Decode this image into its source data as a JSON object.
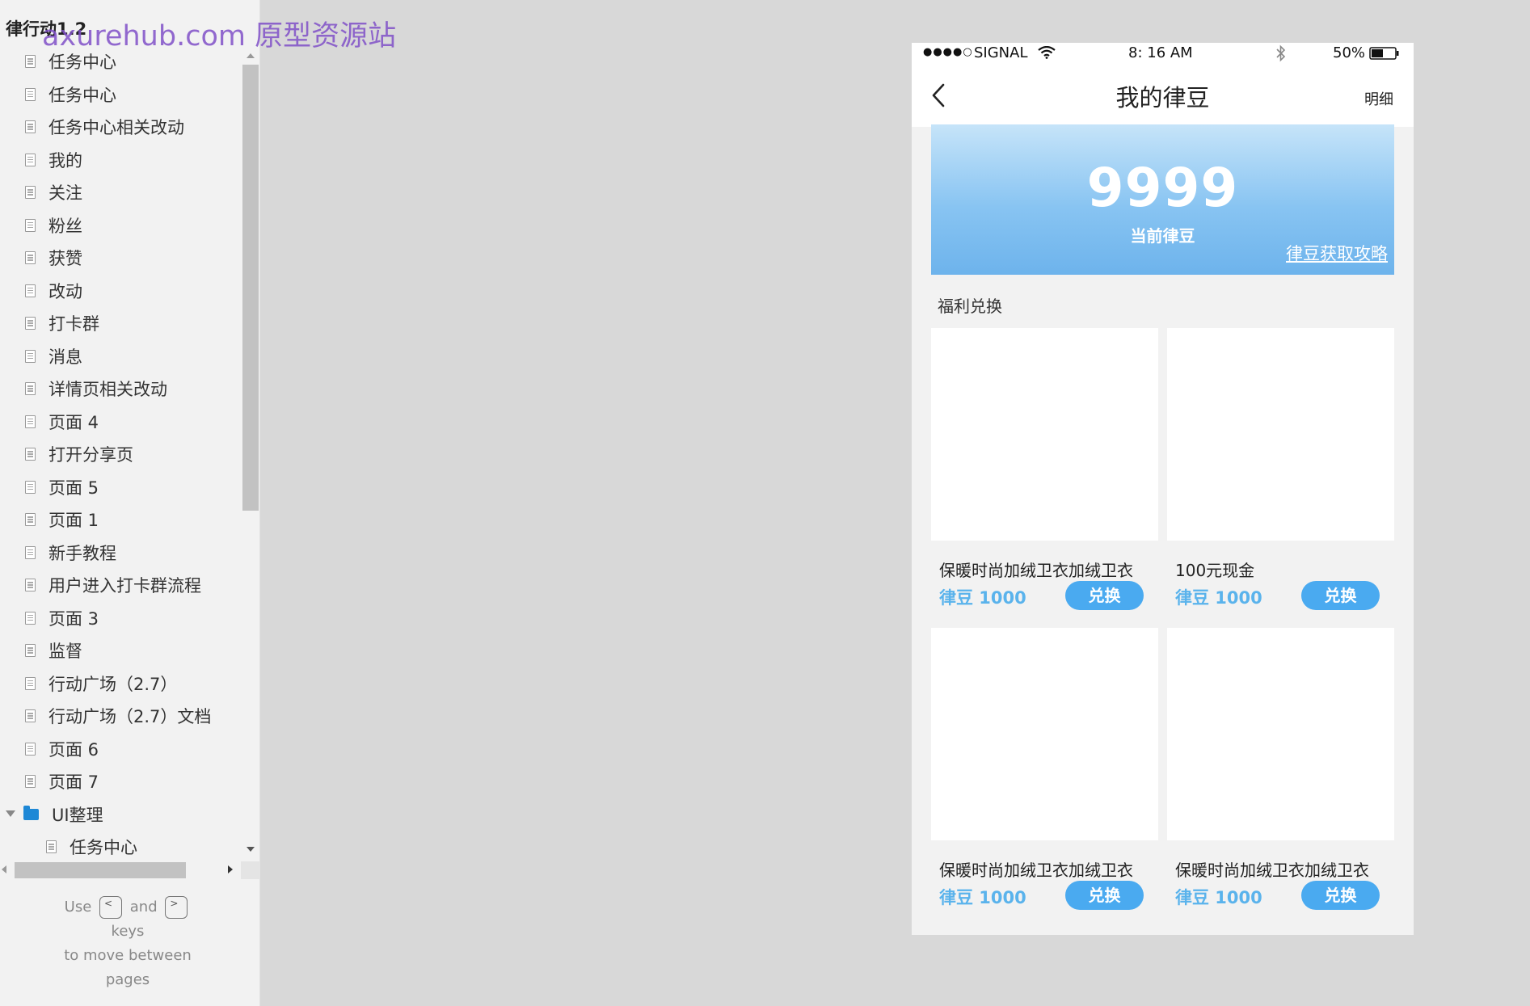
{
  "sidebar": {
    "project_title": "律行动1.2",
    "watermark": "axurehub.com 原型资源站",
    "pages": [
      {
        "label": "任务中心"
      },
      {
        "label": "任务中心"
      },
      {
        "label": "任务中心相关改动"
      },
      {
        "label": "我的"
      },
      {
        "label": "关注"
      },
      {
        "label": "粉丝"
      },
      {
        "label": "获赞"
      },
      {
        "label": "改动"
      },
      {
        "label": "打卡群"
      },
      {
        "label": "消息"
      },
      {
        "label": "详情页相关改动"
      },
      {
        "label": "页面 4"
      },
      {
        "label": "打开分享页"
      },
      {
        "label": "页面 5"
      },
      {
        "label": "页面 1"
      },
      {
        "label": "新手教程"
      },
      {
        "label": "用户进入打卡群流程"
      },
      {
        "label": "页面 3"
      },
      {
        "label": "监督"
      },
      {
        "label": "行动广场（2.7）"
      },
      {
        "label": "行动广场（2.7）文档"
      },
      {
        "label": "页面 6"
      },
      {
        "label": "页面 7"
      }
    ],
    "folder": {
      "label": "UI整理",
      "expanded": true
    },
    "folder_children": [
      {
        "label": "任务中心"
      }
    ],
    "nav_hint": {
      "use": "Use",
      "and": "and",
      "keys": "keys",
      "line2": "to move between",
      "line3": "pages",
      "prev_key": "<",
      "next_key": ">"
    }
  },
  "phone": {
    "status_bar": {
      "signal": "●●●●○",
      "carrier": "SIGNAL",
      "time": "8: 16 AM",
      "battery": "50%",
      "battery_level": 0.5
    },
    "nav": {
      "back_icon": "chevron-left-icon",
      "title": "我的律豆",
      "detail": "明细"
    },
    "banner": {
      "count": "9999",
      "label": "当前律豆",
      "guide_link": "律豆获取攻略"
    },
    "section_title": "福利兑换",
    "products": [
      {
        "name": "保暖时尚加绒卫衣加绒卫衣",
        "price": "律豆 1000",
        "button": "兑换"
      },
      {
        "name": "100元现金",
        "price": "律豆 1000",
        "button": "兑换"
      },
      {
        "name": "保暖时尚加绒卫衣加绒卫衣",
        "price": "律豆 1000",
        "button": "兑换"
      },
      {
        "name": "保暖时尚加绒卫衣加绒卫衣",
        "price": "律豆 1000",
        "button": "兑换"
      }
    ]
  },
  "colors": {
    "accent": "#4aaaf0",
    "price": "#5ab3ec",
    "folder": "#1e88d6",
    "canvas": "#d8d8d8"
  }
}
